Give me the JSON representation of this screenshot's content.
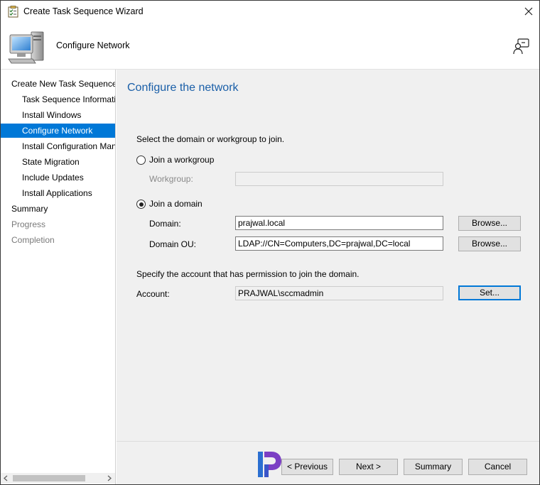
{
  "window": {
    "title": "Create Task Sequence Wizard"
  },
  "header": {
    "title": "Configure Network"
  },
  "nav": {
    "items": [
      {
        "label": "Create New Task Sequence"
      },
      {
        "label": "Task Sequence Information"
      },
      {
        "label": "Install Windows"
      },
      {
        "label": "Configure Network"
      },
      {
        "label": "Install Configuration Manager"
      },
      {
        "label": "State Migration"
      },
      {
        "label": "Include Updates"
      },
      {
        "label": "Install Applications"
      },
      {
        "label": "Summary"
      },
      {
        "label": "Progress"
      },
      {
        "label": "Completion"
      }
    ],
    "selected": "Configure Network"
  },
  "page": {
    "title": "Configure the network",
    "intro": "Select the domain or workgroup to join.",
    "workgroup_radio_label": "Join a workgroup",
    "workgroup_label": "Workgroup:",
    "workgroup_value": "",
    "domain_radio_label": "Join a domain",
    "domain_selected": true,
    "domain_label": "Domain:",
    "domain_value": "prajwal.local",
    "domain_ou_label": "Domain OU:",
    "domain_ou_value": "LDAP://CN=Computers,DC=prajwal,DC=local",
    "browse_label": "Browse...",
    "account_intro": "Specify the account that has permission to join the domain.",
    "account_label": "Account:",
    "account_value": "PRAJWAL\\sccmadmin",
    "set_label": "Set..."
  },
  "footer": {
    "previous_label": "< Previous",
    "next_label": "Next >",
    "summary_label": "Summary",
    "cancel_label": "Cancel"
  },
  "icons": {
    "title": "task-sequence-icon",
    "header": "computer-monitor-icon",
    "help": "help-person-icon",
    "close": "close-icon",
    "watermark": "logo-icon"
  },
  "colors": {
    "accent": "#0078d7",
    "page_title": "#1a5fa8",
    "content_bg": "#f0f0f0"
  }
}
